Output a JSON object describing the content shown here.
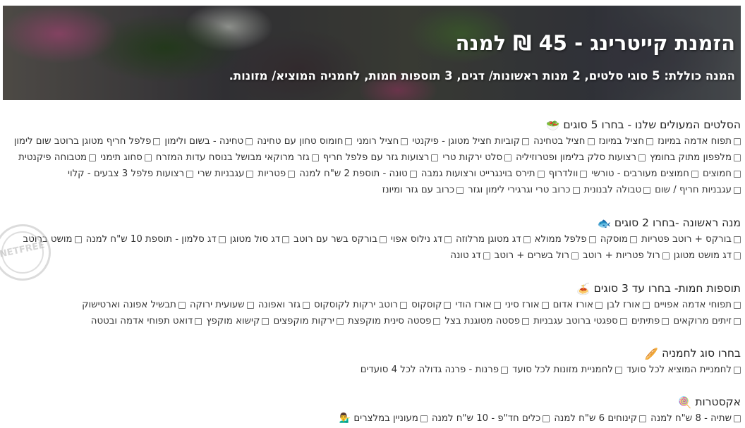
{
  "hero": {
    "title": "הזמנת קייטרינג - 45 ₪ למנה",
    "subtitle": "המנה כוללת: 5 סוגי סלטים, 2 מנות ראשונות/ דגים, 3 תוספות חמות, לחמניה המוציא/ מזונות."
  },
  "sections": [
    {
      "title": "הסלטים המעולים שלנו - בחרו 5 סוגים",
      "icon": "salad-bowl-icon",
      "emoji": "🥗",
      "rows": [
        [
          "תפוח אדמה במיונז",
          "חציל במיונז",
          "חציל בטחינה",
          "קוביות חציל מטוגן - פיקנטי",
          "חציל רומני",
          "חומוס טחון עם טחינה",
          "טחינה - בשום ולימון",
          "פלפל חריף מטוגן ברוטב שום לימון"
        ],
        [
          "מלפפון מתוק בחומץ",
          "רצועות סלק בלימון ופטרוזיליה",
          "סלט ירקות טרי",
          "רצועות גזר עם פלפל חריף",
          "גזר מרוקאי מבושל בנוסח עדות המזרח",
          "סחוג תימני",
          "מטבוחה פיקנטית"
        ],
        [
          "חמוצים",
          "חמוצים מעורבים - טורשי",
          "וולדרוף",
          "תירס בוינגרייט ורצועות גמבה",
          "טונה - תוספת 2 ש\"ח למנה",
          "פטריות",
          "עגבניות שרי",
          "רצועות פלפל 3 צבעים - קלוי"
        ],
        [
          "עגבניות חריף / שום",
          "טבולה לבנונית",
          "כרוב טרי וגרגירי לימון וגזר",
          "כרוב עם גזר ומיונז"
        ]
      ]
    },
    {
      "title": "מנה ראשונה -בחרו 2 סוגים",
      "icon": "fish-icon",
      "emoji": "🐟",
      "rows": [
        [
          "בורקס + רוטב פטריות",
          "מוסקה",
          "פלפל ממולא",
          "דג מטוגן מרלוזה",
          "דג נילוס אפוי",
          "בורקס בשר עם רוטב",
          "דג סול מטוגן",
          "דג סלמון - תוספת 10 ש\"ח למנה",
          "מושט ברוטב"
        ],
        [
          "דג מושט מטוגן",
          "רול פטריות + רוטב",
          "רול בשרים + רוטב",
          "דג טונה"
        ]
      ]
    },
    {
      "title": "תוספות חמות- בחרו עד 3 סוגים",
      "icon": "hot-dish-icon",
      "emoji": "🍝",
      "rows": [
        [
          "תפוחי אדמה אפויים",
          "אורז לבן",
          "אורז אדום",
          "אורז סיני",
          "אורז הודי",
          "קוסקוס",
          "רוטב ירקות לקוסקוס",
          "גזר ואפונה",
          "שעועית ירוקה",
          "תבשיל אפונה וארטישוק"
        ],
        [
          "זיתים מרוקאים",
          "פתיתים",
          "ספגטי ברוטב עגבניות",
          "פסטה מטוגנת בצל",
          "פסטה סינית מוקפצת",
          "ירקות מוקפצים",
          "קישוא מוקפץ",
          "דואט תפוחי אדמה ובטטה"
        ]
      ]
    },
    {
      "title": "בחרו סוג לחמניה",
      "icon": "bread-icon",
      "emoji": "🥖",
      "rows": [
        [
          "לחמניית המוציא לכל סועד",
          "לחמניית מזונות לכל סועד",
          "פרנות - פרנה גדולה לכל 4 סועדים"
        ]
      ]
    },
    {
      "title": "אקסטרות",
      "icon": "lollipop-icon",
      "emoji": "🍭",
      "rows": [
        [
          "שתיה - 8 ש\"ח למנה",
          "קינוחים 6 ש\"ח למנה",
          "כלים חד\"פ - 10 ש\"ח למנה",
          "מעוניין במלצרים 💁‍♂️"
        ]
      ]
    }
  ],
  "watermark": {
    "text": "NETFREE"
  }
}
